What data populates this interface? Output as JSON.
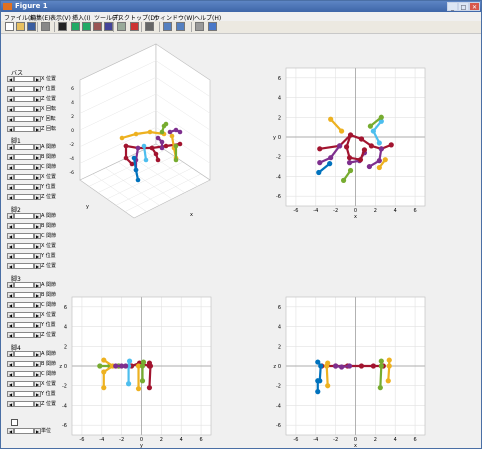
{
  "window": {
    "title": "Figure 1",
    "min": "_",
    "max": "□",
    "close": "✕"
  },
  "menus": [
    "ファイル(F)",
    "編集(E)",
    "表示(V)",
    "挿入(I)",
    "ツール(T)",
    "デスクトップ(D)",
    "ウィンドウ(W)",
    "ヘルプ(H)"
  ],
  "toolbar": [
    "new-icon",
    "open-icon",
    "save-icon",
    "print-icon",
    "pointer-icon",
    "zoom-in-icon",
    "zoom-out-icon",
    "pan-icon",
    "rotate-icon",
    "datatip-icon",
    "brush-icon",
    "link-icon",
    "colorbar-icon",
    "legend-icon",
    "hide-plot-icon",
    "show-plot-icon"
  ],
  "panels": [
    {
      "title": "バス",
      "rows": [
        "X 位置",
        "Y 位置",
        "Z 位置",
        "X 回転",
        "Y 回転",
        "Z 回転"
      ]
    },
    {
      "title": "脚1",
      "rows": [
        "A 関節",
        "B 関節",
        "C 関節",
        "X 位置",
        "Y 位置",
        "Z 位置"
      ]
    },
    {
      "title": "脚2",
      "rows": [
        "A 関節",
        "B 関節",
        "C 関節",
        "X 位置",
        "Y 位置",
        "Z 位置"
      ]
    },
    {
      "title": "脚3",
      "rows": [
        "A 関節",
        "B 関節",
        "C 関節",
        "X 位置",
        "Y 位置",
        "Z 位置"
      ]
    },
    {
      "title": "脚4",
      "rows": [
        "A 関節",
        "B 関節",
        "C 関節",
        "X 位置",
        "Y 位置",
        "Z 位置"
      ]
    }
  ],
  "checkbox": {
    "label": "単位"
  },
  "axes": {
    "xy": {
      "ticks": [
        "-6",
        "-4",
        "-2",
        "0",
        "2",
        "4",
        "6"
      ],
      "xlabel": "x",
      "ylabel": "y"
    },
    "xz": {
      "ticks": [
        "-6",
        "-4",
        "-2",
        "0",
        "2",
        "4",
        "6"
      ],
      "xlabel": "x",
      "ylabel": "z"
    },
    "yz": {
      "ticks": [
        "-6",
        "-4",
        "-2",
        "0",
        "2",
        "4",
        "6"
      ],
      "xlabel": "y",
      "ylabel": "z"
    },
    "iso": {
      "xlabel": "x",
      "ylabel": "y",
      "zticks": [
        "-6",
        "-4",
        "-2",
        "0",
        "2",
        "4",
        "6"
      ]
    }
  },
  "colors": {
    "red": "#a2142f",
    "purple": "#7e2f8e",
    "orange": "#edb120",
    "blue": "#0072bd",
    "cyan": "#4dbeee",
    "green": "#77ac30"
  }
}
